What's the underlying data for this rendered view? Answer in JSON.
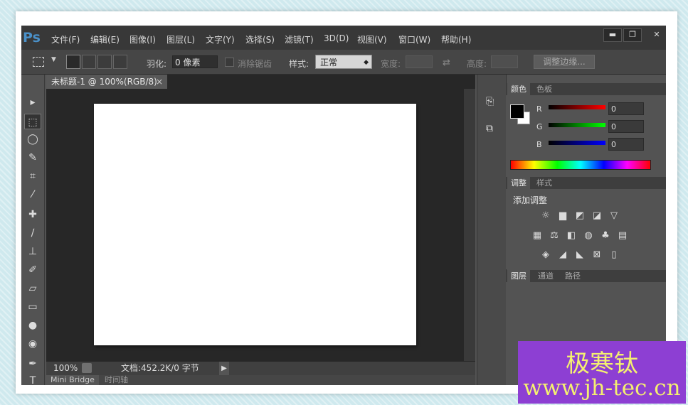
{
  "app": {
    "logo": "Ps"
  },
  "menu": {
    "items": [
      "文件(F)",
      "编辑(E)",
      "图像(I)",
      "图层(L)",
      "文字(Y)",
      "选择(S)",
      "滤镜(T)",
      "3D(D)",
      "视图(V)",
      "窗口(W)",
      "帮助(H)"
    ]
  },
  "window_controls": {
    "minimize": "▬",
    "maximize": "❐",
    "close": "✕"
  },
  "options": {
    "feather_label": "羽化:",
    "feather_value": "0 像素",
    "antialias_label": "消除锯齿",
    "style_label": "样式:",
    "style_value": "正常",
    "width_label": "宽度:",
    "height_label": "高度:",
    "refine_button": "调整边缘..."
  },
  "document": {
    "tab_title": "未标题-1 @ 100%(RGB/8)",
    "close_glyph": "×",
    "zoom": "100%",
    "doc_info": "文档:452.2K/0 字节",
    "bottom_tabs": [
      "Mini Bridge",
      "时间轴"
    ]
  },
  "color_panel": {
    "tabs": [
      "颜色",
      "色板"
    ],
    "channels": [
      {
        "name": "R",
        "value": "0"
      },
      {
        "name": "G",
        "value": "0"
      },
      {
        "name": "B",
        "value": "0"
      }
    ]
  },
  "adjust_panel": {
    "tabs": [
      "调整",
      "样式"
    ],
    "heading": "添加调整"
  },
  "layers_panel": {
    "tabs": [
      "图层",
      "通道",
      "路径"
    ]
  },
  "watermark": {
    "line1": "极寒钛",
    "line2": "www.jh-tec.cn"
  },
  "colors": {
    "accent": "#4a90c8",
    "watermark_bg": "#8d3fd3",
    "watermark_text": "#f4f070"
  }
}
